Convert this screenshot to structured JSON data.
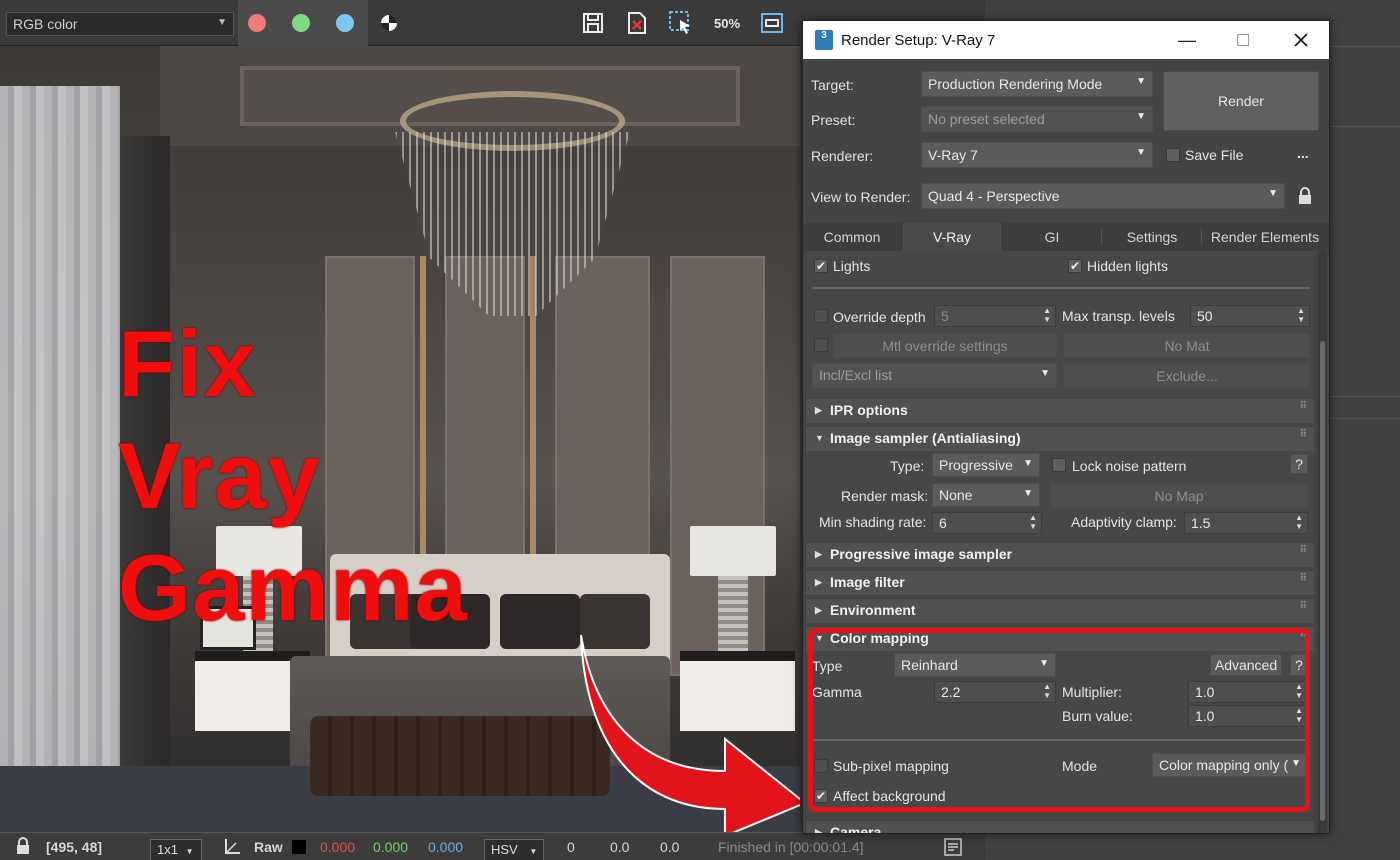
{
  "framebuffer": {
    "channel": "RGB color",
    "zoom_label": "50"
  },
  "overlay": {
    "title_lines": [
      "Fix",
      "Vray",
      "Gamma"
    ]
  },
  "status_bar": {
    "coords": "[495, 48]",
    "region": "1x1",
    "raw_label": "Raw",
    "r": "0.000",
    "g": "0.000",
    "b": "0.000",
    "color_space": "HSV",
    "h": "0",
    "s": "0.0",
    "v": "0.0",
    "status": "Finished in [00:00:01.4]"
  },
  "dialog": {
    "title": "Render Setup: V-Ray 7",
    "app_icon": "3",
    "target_label": "Target:",
    "target_value": "Production Rendering Mode",
    "preset_label": "Preset:",
    "preset_value": "No preset selected",
    "renderer_label": "Renderer:",
    "renderer_value": "V-Ray 7",
    "save_file_label": "Save File",
    "more_label": "...",
    "render_button": "Render",
    "view_label": "View to Render:",
    "view_value": "Quad 4 - Perspective",
    "tabs": [
      "Common",
      "V-Ray",
      "GI",
      "Settings",
      "Render Elements"
    ],
    "global": {
      "lights": "Lights",
      "hidden_lights": "Hidden lights",
      "override_depth": "Override depth",
      "override_depth_value": "5",
      "max_transp_label": "Max transp. levels",
      "max_transp_value": "50",
      "mtl_override": "Mtl override settings",
      "no_mat": "No Mat",
      "incl_excl": "Incl/Excl list",
      "exclude": "Exclude..."
    },
    "rollouts": {
      "ipr": "IPR options",
      "image_sampler": "Image sampler (Antialiasing)",
      "progressive": "Progressive image sampler",
      "image_filter": "Image filter",
      "environment": "Environment",
      "color_mapping": "Color mapping",
      "camera": "Camera"
    },
    "sampler": {
      "type_label": "Type:",
      "type_value": "Progressive",
      "lock_noise": "Lock noise pattern",
      "help": "?",
      "mask_label": "Render mask:",
      "mask_value": "None",
      "no_map": "No Map",
      "min_rate_label": "Min shading rate:",
      "min_rate_value": "6",
      "clamp_label": "Adaptivity clamp:",
      "clamp_value": "1.5"
    },
    "color_mapping": {
      "type_label": "Type",
      "type_value": "Reinhard",
      "advanced": "Advanced",
      "help": "?",
      "gamma_label": "Gamma",
      "gamma_value": "2.2",
      "multiplier_label": "Multiplier:",
      "multiplier_value": "1.0",
      "burn_label": "Burn value:",
      "burn_value": "1.0",
      "subpixel": "Sub-pixel mapping",
      "mode_label": "Mode",
      "mode_value": "Color mapping only (",
      "affect_bg": "Affect background"
    }
  }
}
